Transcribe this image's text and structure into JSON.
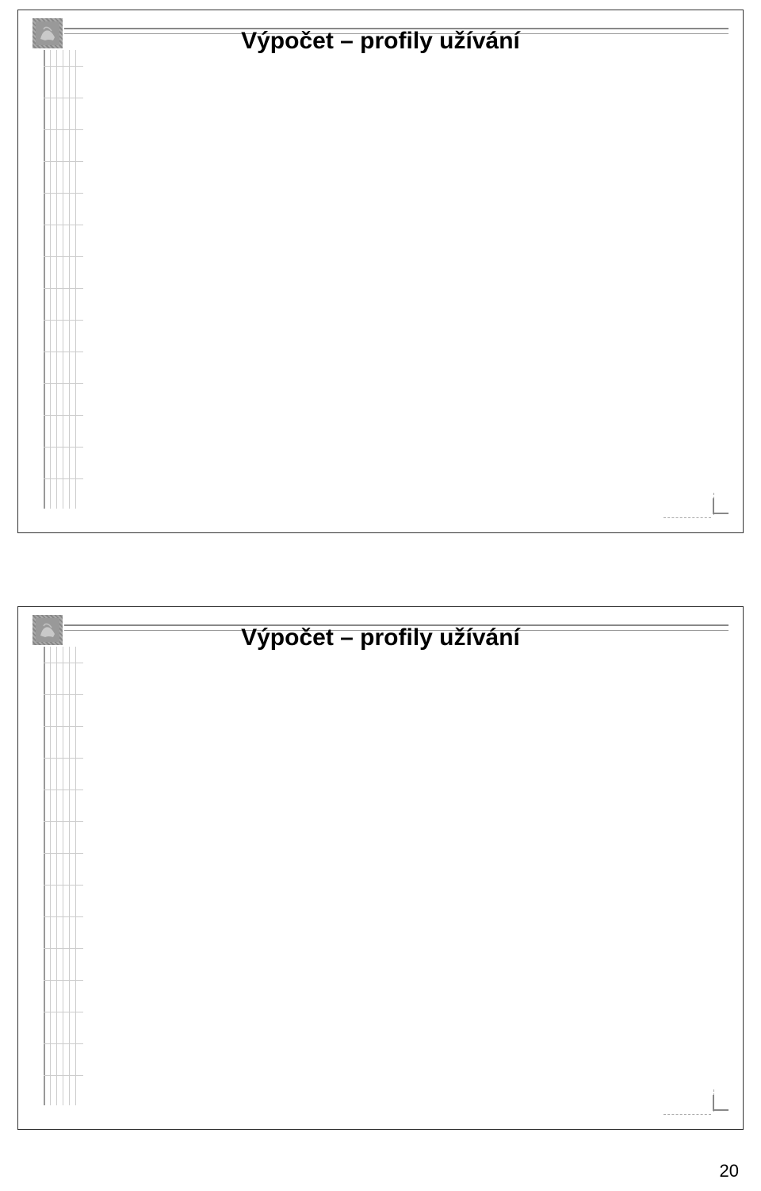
{
  "slides": [
    {
      "title": "Výpočet – profily užívání"
    },
    {
      "title": "Výpočet – profily užívání"
    }
  ],
  "page_number": "20"
}
